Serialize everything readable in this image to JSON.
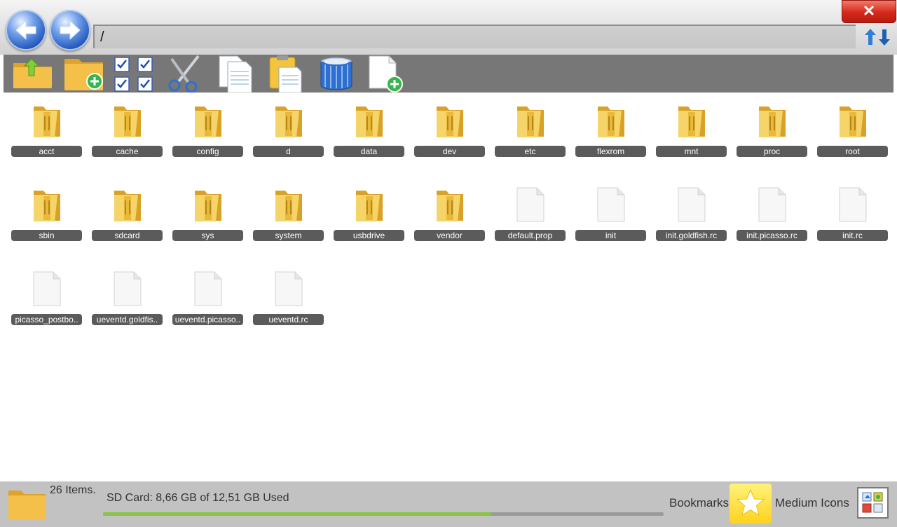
{
  "window": {
    "close_label": "✕"
  },
  "navigation": {
    "back_icon": "back-arrow-icon",
    "forward_icon": "forward-arrow-icon",
    "path": "/",
    "refresh_icon": "refresh-arrows-icon"
  },
  "toolbar": {
    "tools": [
      {
        "name": "up-folder",
        "icon": "folder-up-icon"
      },
      {
        "name": "new-folder",
        "icon": "folder-add-icon"
      },
      {
        "name": "select-all",
        "icon": "checkboxes-icon"
      },
      {
        "name": "cut",
        "icon": "scissors-icon"
      },
      {
        "name": "copy",
        "icon": "copy-icon"
      },
      {
        "name": "paste",
        "icon": "paste-icon"
      },
      {
        "name": "delete",
        "icon": "trash-bin-icon"
      },
      {
        "name": "new-file",
        "icon": "file-add-icon"
      }
    ]
  },
  "files": [
    {
      "name": "acct",
      "type": "folder"
    },
    {
      "name": "cache",
      "type": "folder"
    },
    {
      "name": "config",
      "type": "folder"
    },
    {
      "name": "d",
      "type": "folder"
    },
    {
      "name": "data",
      "type": "folder"
    },
    {
      "name": "dev",
      "type": "folder"
    },
    {
      "name": "etc",
      "type": "folder"
    },
    {
      "name": "flexrom",
      "type": "folder"
    },
    {
      "name": "mnt",
      "type": "folder"
    },
    {
      "name": "proc",
      "type": "folder"
    },
    {
      "name": "root",
      "type": "folder"
    },
    {
      "name": "sbin",
      "type": "folder"
    },
    {
      "name": "sdcard",
      "type": "folder"
    },
    {
      "name": "sys",
      "type": "folder"
    },
    {
      "name": "system",
      "type": "folder"
    },
    {
      "name": "usbdrive",
      "type": "folder"
    },
    {
      "name": "vendor",
      "type": "folder"
    },
    {
      "name": "default.prop",
      "type": "file"
    },
    {
      "name": "init",
      "type": "file"
    },
    {
      "name": "init.goldfish.rc",
      "type": "file"
    },
    {
      "name": "init.picasso.rc",
      "type": "file"
    },
    {
      "name": "init.rc",
      "type": "file"
    },
    {
      "name": "picasso_postbo..",
      "type": "file"
    },
    {
      "name": "ueventd.goldfis..",
      "type": "file"
    },
    {
      "name": "ueventd.picasso..",
      "type": "file"
    },
    {
      "name": "ueventd.rc",
      "type": "file"
    }
  ],
  "status": {
    "items_count": "26 Items.",
    "sd_card_text": "SD Card: 8,66 GB of 12,51 GB Used",
    "sd_used_fraction": 0.692,
    "bookmarks_label": "Bookmarks",
    "view_label": "Medium Icons",
    "colors": {
      "folder": "#f2c94c",
      "label_bg": "#5b5b5b",
      "toolbar_bg": "#777777",
      "status_bg": "#c2c2c2",
      "progress": "#8bc34a",
      "close": "#d5281b"
    }
  }
}
